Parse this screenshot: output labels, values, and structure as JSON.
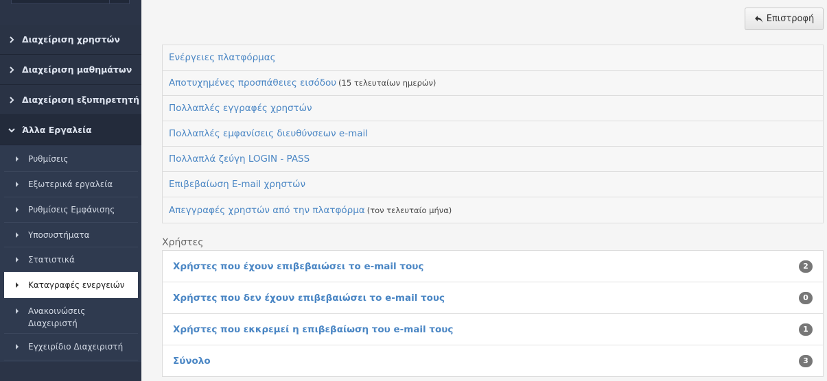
{
  "sidebar": {
    "menus": [
      {
        "label": "Διαχείριση χρηστών",
        "expanded": false
      },
      {
        "label": "Διαχείριση μαθημάτων",
        "expanded": false
      },
      {
        "label": "Διαχείριση εξυπηρετητή",
        "expanded": false
      },
      {
        "label": "Άλλα Εργαλεία",
        "expanded": true
      }
    ],
    "subitems": [
      {
        "label": "Ρυθμίσεις"
      },
      {
        "label": "Εξωτερικά εργαλεία"
      },
      {
        "label": "Ρυθμίσεις Εμφάνισης"
      },
      {
        "label": "Υποσυστήματα"
      },
      {
        "label": "Στατιστικά"
      },
      {
        "label": "Καταγραφές ενεργειών",
        "active": true
      },
      {
        "label": "Ανακοινώσεις Διαχειριστή"
      },
      {
        "label": "Εγχειρίδιο Διαχειριστή"
      }
    ]
  },
  "toolbar": {
    "back_label": "Επιστροφή"
  },
  "tools": [
    {
      "label": "Ενέργειες πλατφόρμας",
      "note": ""
    },
    {
      "label": "Αποτυχημένες προσπάθειες εισόδου",
      "note": "(15 τελευταίων ημερών)"
    },
    {
      "label": "Πολλαπλές εγγραφές χρηστών",
      "note": ""
    },
    {
      "label": "Πολλαπλές εμφανίσεις διευθύνσεων e-mail",
      "note": ""
    },
    {
      "label": "Πολλαπλά ζεύγη LOGIN - PASS",
      "note": ""
    },
    {
      "label": "Επιβεβαίωση E-mail χρηστών",
      "note": ""
    },
    {
      "label": "Απεγγραφές χρηστών από την πλατφόρμα",
      "note": "(τον τελευταίο μήνα)"
    }
  ],
  "users": {
    "title": "Χρήστες",
    "rows": [
      {
        "label": "Χρήστες που έχουν επιβεβαιώσει το e-mail τους",
        "count": "2"
      },
      {
        "label": "Χρήστες που δεν έχουν επιβεβαιώσει το e-mail τους",
        "count": "0"
      },
      {
        "label": "Χρήστες που εκκρεμεί η επιβεβαίωση του e-mail τους",
        "count": "1"
      },
      {
        "label": "Σύνολο",
        "count": "3"
      }
    ]
  },
  "colors": {
    "sidebar_bg": "#2b3447",
    "link": "#4a86c4",
    "badge": "#777777"
  }
}
